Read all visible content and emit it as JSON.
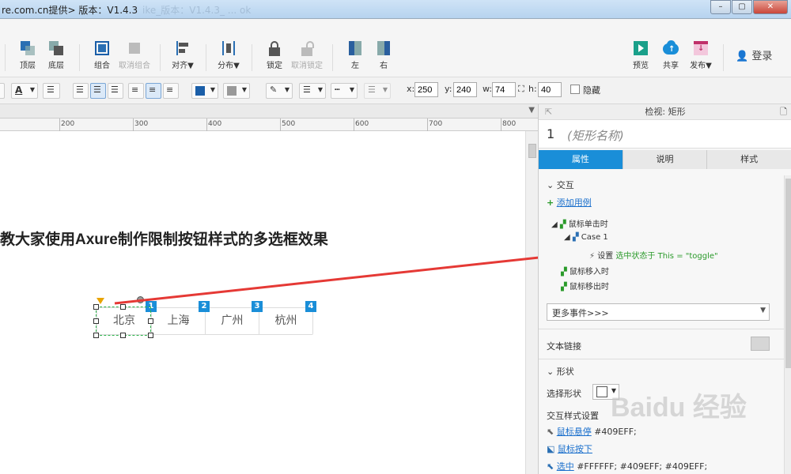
{
  "window": {
    "title": "re.com.cn提供> 版本：V1.4.3",
    "ghost_title": "ike_版本：V1.4.3_ ... ok"
  },
  "toolbar": {
    "buttons": [
      {
        "label": "顶层",
        "icon": "bring-to-front-icon"
      },
      {
        "label": "底层",
        "icon": "send-to-back-icon"
      },
      {
        "label": "组合",
        "icon": "group-icon"
      },
      {
        "label": "取消组合",
        "icon": "ungroup-icon"
      },
      {
        "label": "对齐▼",
        "icon": "align-icon"
      },
      {
        "label": "分布▼",
        "icon": "distribute-icon"
      },
      {
        "label": "锁定",
        "icon": "lock-icon"
      },
      {
        "label": "取消锁定",
        "icon": "unlock-icon"
      },
      {
        "label": "左",
        "icon": "left-icon"
      },
      {
        "label": "右",
        "icon": "right-icon"
      },
      {
        "label": "预览",
        "icon": "preview-icon"
      },
      {
        "label": "共享",
        "icon": "share-icon"
      },
      {
        "label": "发布▼",
        "icon": "publish-icon"
      }
    ],
    "login_label": "登录",
    "colors": {
      "preview": "#1aa08a",
      "share": "#1a8ed8",
      "publish": "#c0306a"
    }
  },
  "format": {
    "x_label": "x:",
    "x_value": "250",
    "y_label": "y:",
    "y_value": "240",
    "w_label": "w:",
    "w_value": "74",
    "h_label": "h:",
    "h_value": "40",
    "hide_label": "隐藏"
  },
  "ruler": {
    "labels": [
      "200",
      "300",
      "400",
      "500",
      "600",
      "700",
      "800"
    ]
  },
  "canvas": {
    "headline": "教大家使用Axure制作限制按钮样式的多选框效果",
    "cities": [
      "北京",
      "上海",
      "广州",
      "杭州"
    ],
    "badges": [
      "1",
      "2",
      "3",
      "4"
    ]
  },
  "panel": {
    "header": "检视: 矩形",
    "shape_number": "1",
    "shape_name": "(矩形名称)",
    "tabs": [
      "属性",
      "说明",
      "样式"
    ],
    "interaction_title": "交互",
    "add_case": "添加用例",
    "events": {
      "click": "鼠标单击时",
      "case": "Case 1",
      "action_prefix": "设置",
      "action_detail": "选中状态于 This = \"toggle\"",
      "mouse_enter": "鼠标移入时",
      "mouse_leave": "鼠标移出时"
    },
    "more_events": "更多事件>>>",
    "text_link": "文本链接",
    "shape_title": "形状",
    "select_shape": "选择形状",
    "interaction_style": "交互样式设置",
    "hover_label": "鼠标悬停",
    "hover_value": "#409EFF;",
    "mousedown_label": "鼠标按下",
    "selected_label": "选中",
    "selected_value": "#FFFFFF; #409EFF; #409EFF;"
  },
  "watermark": "Baidu 经验"
}
